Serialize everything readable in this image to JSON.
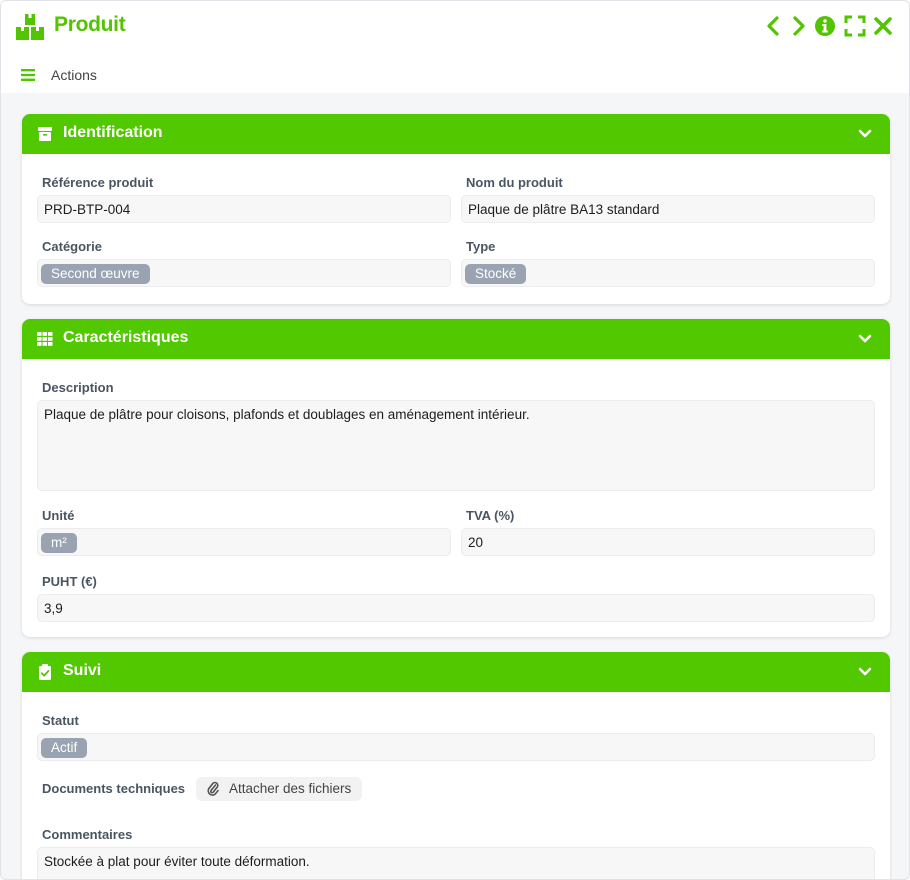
{
  "window": {
    "title": "Produit",
    "accent_color": "#52c800",
    "header_icons": [
      "previous-icon",
      "next-icon",
      "info-icon",
      "fullscreen-icon",
      "close-icon"
    ]
  },
  "actions": {
    "label": "Actions"
  },
  "sections": {
    "identification": {
      "title": "Identification",
      "icon": "box-icon",
      "fields": {
        "reference": {
          "label": "Référence produit",
          "value": "PRD-BTP-004"
        },
        "name": {
          "label": "Nom du produit",
          "value": "Plaque de plâtre BA13 standard"
        },
        "category": {
          "label": "Catégorie",
          "tag": "Second œuvre"
        },
        "type": {
          "label": "Type",
          "tag": "Stocké"
        }
      }
    },
    "characteristics": {
      "title": "Caractéristiques",
      "icon": "table-icon",
      "fields": {
        "description": {
          "label": "Description",
          "value": "Plaque de plâtre pour cloisons, plafonds et doublages en aménagement intérieur."
        },
        "unit": {
          "label": "Unité",
          "tag": "m²"
        },
        "vat": {
          "label": "TVA (%)",
          "value": "20"
        },
        "price": {
          "label": "PUHT (€)",
          "value": "3,9"
        }
      }
    },
    "tracking": {
      "title": "Suivi",
      "icon": "clipboard-check-icon",
      "fields": {
        "status": {
          "label": "Statut",
          "tag": "Actif"
        },
        "documents": {
          "label": "Documents techniques",
          "button": "Attacher des fichiers"
        },
        "comments": {
          "label": "Commentaires",
          "value": "Stockée à plat pour éviter toute déformation."
        }
      }
    }
  }
}
